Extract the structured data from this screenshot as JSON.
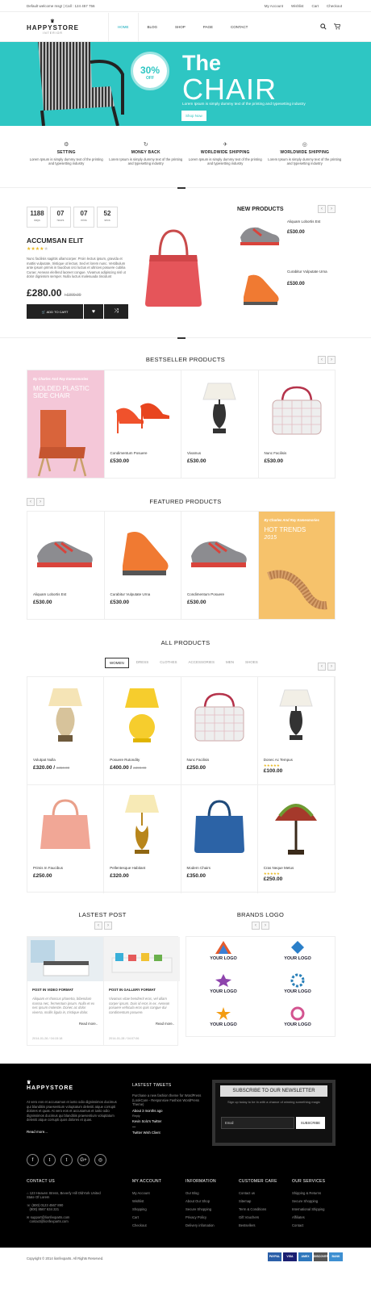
{
  "topbar": {
    "welcome": "Default welcome msg! | Call : 124 457 756",
    "links": [
      "My Account",
      "Wishlist",
      "Cart",
      "Checkout"
    ]
  },
  "header": {
    "logo": "HAPPYSTORE",
    "logo_sub": "INTERIOR",
    "nav": [
      "HOME",
      "BLOG",
      "SHOP",
      "PAGE",
      "CONTACT"
    ]
  },
  "hero": {
    "badge_pct": "30%",
    "badge_off": "OFF",
    "title1": "The",
    "title2": "CHAIR",
    "sub": "Lorem Ipsum is simply dummy text of the printing and typesetting industry",
    "button": "Shop Now",
    "accent": "#2ec6c3"
  },
  "features": [
    {
      "title": "SETTING",
      "text": "Lorem Ipsum is simply dummy text of the printing and typesetting industry",
      "icon": "gear-icon"
    },
    {
      "title": "MONEY BACK",
      "text": "Lorem Ipsum is simply dummy text of the printing and typesetting industry",
      "icon": "refresh-icon"
    },
    {
      "title": "WORLDWIDE SHIPPING",
      "text": "Lorem Ipsum is simply dummy text of the printing and typesetting industry",
      "icon": "plane-icon"
    },
    {
      "title": "WORLDWIDE SHIPPING",
      "text": "Lorem Ipsum is simply dummy text of the printing and typesetting industry",
      "icon": "globe-icon"
    }
  ],
  "deal": {
    "countdown": [
      {
        "v": "1188",
        "u": "days"
      },
      {
        "v": "07",
        "u": "hours"
      },
      {
        "v": "07",
        "u": "mins"
      },
      {
        "v": "52",
        "u": "secs"
      }
    ],
    "name": "ACCUMSAN ELIT",
    "rating": 4,
    "desc": "Nunc facilisis sagittis ullamcorper. Proin lectus ipsum, gravida et mattis vulputate, tristique ut lectus. Sed et lorem nunc. Vestibulum ante ipsum primis in faucibus orci luctus et ultrices posuere cubilia Curae; Aenean eleifend laoreet congue. Vivamus adipiscing nisl ut dolor dignissim semper. Nulla luctus malesuada tincidunt",
    "price": "£280.00",
    "old": "/ £300.00",
    "add": "ADD TO CART"
  },
  "new_products": {
    "title": "NEW PRODUCTS",
    "items": [
      {
        "name": "Aliquam Lobortis Est",
        "price": "£530.00"
      },
      {
        "name": "Curabitur Vulputate Urna",
        "price": "£530.00"
      }
    ]
  },
  "bestseller": {
    "title": "BESTSELLER PRODUCTS",
    "promo_kicker": "By Charles And Ray Eamesmories",
    "promo_title": "MOLDED PLASTIC SIDE CHAIR",
    "promo_title_accent": "CHAIR",
    "items": [
      {
        "name": "Condimentum Posuere",
        "price": "£530.00"
      },
      {
        "name": "Vivamus",
        "price": "£530.00"
      },
      {
        "name": "Nunc Facilisis",
        "price": "£530.00"
      }
    ]
  },
  "featured": {
    "title": "FEATURED PRODUCTS",
    "promo_kicker": "By Charles And Ray Eamesmories",
    "promo_title": "HOT TRENDS",
    "promo_year": "2015",
    "items": [
      {
        "name": "Aliquam Lobortis Est",
        "price": "£530.00"
      },
      {
        "name": "Curabitur Vulputate Urna",
        "price": "£530.00"
      },
      {
        "name": "Condimentum Posuere",
        "price": "£530.00"
      }
    ]
  },
  "all": {
    "title": "ALL PRODUCTS",
    "tabs": [
      "WOMEN",
      "DRESS",
      "CLOTHES",
      "ACCESSORIES",
      "MEN",
      "SHOES"
    ],
    "items": [
      {
        "name": "Volutpat Nulla",
        "price": "£320.00 /",
        "old": "£350.00"
      },
      {
        "name": "Posuere Rutondity",
        "price": "£400.00 /",
        "old": "£390.00"
      },
      {
        "name": "Nunc Facilisis",
        "price": "£250.00",
        "old": ""
      },
      {
        "name": "Donec Ac Tempus",
        "price": "£100.00",
        "old": ""
      },
      {
        "name": "Primis In Faucibus",
        "price": "£250.00",
        "old": ""
      },
      {
        "name": "Pellentesque Habitant",
        "price": "£320.00",
        "old": ""
      },
      {
        "name": "Modern Chairs",
        "price": "£350.00",
        "old": ""
      },
      {
        "name": "Cras Neque Metus",
        "price": "£250.00",
        "old": ""
      }
    ]
  },
  "posts": {
    "title": "LASTEST POST",
    "items": [
      {
        "title": "POST IN VIDEO FORMAT",
        "desc": "Aliquam et rhoncus pharetra, bibendum massa nec, fermentum ipsum. Nulla et ex nec ipsum molestie. Donec ac dolor viverra, mollis ligula in, tristique dolor.",
        "more": "Read more..",
        "date": "2014-01-26 / 04:15:18"
      },
      {
        "title": "POST IN GALLERY FORMAT",
        "desc": "Vivamus vitae hendrerit eros, vel ullam corper ipsum. Duis id eros in ex. Aenean posuere vehicula eros quis congue dui condimentum posuere.",
        "more": "Read more..",
        "date": "2014-01-28 / 04:07:06"
      }
    ]
  },
  "brands": {
    "title": "BRANDS LOGO",
    "label": "YOUR LOGO"
  },
  "footer": {
    "logo": "HAPPYSTORE",
    "text": "At vero eos et accusamus et iusto odio dignissimos ducimus qui blanditiis praesentium voluptatum deleniti atque corrupti dolores et quas. At vero eos et accusamus et iusto odio dignissimos ducimus qui blanditiis praesentium voluptatum deleniti atque corrupti quos dolores et quas.",
    "more": "Read more...",
    "social": [
      "f",
      "t",
      "t",
      "G+",
      "◎"
    ],
    "tweets_title": "LASTEST TWEETS",
    "tweet": "Purchase a new fashion theme for WordPress (LookCare - Responsive Fashion WordPress Theme)",
    "tweet_time": "About 3 months ago",
    "tweet_reply": "Reply",
    "tweet_by": "Kevin Solo's Twitter",
    "tweet_dash": "—",
    "tweet_visit": "Twitter Wish Client",
    "news_title": "SUBSCRIBE TO OUR NEWSLETTER",
    "news_text": "Sign up today to be in with a chance of winning something magic",
    "news_placeholder": "Email",
    "news_button": "SUBSCRIBE",
    "contact_title": "CONTACT US",
    "contact": [
      "123 Heaven Stress, Beverly Hill OldYork United State Of Lorem",
      "(800) 0123 4567 890",
      "(800) 8567 634 221",
      "support@lionfexparts.com",
      "contact@lionfexparts.com"
    ],
    "cols": [
      {
        "title": "MY ACCOUNT",
        "items": [
          "My Account",
          "Wishlist",
          "Shopping",
          "Cart",
          "Checkout"
        ]
      },
      {
        "title": "INFORMATION",
        "items": [
          "Our Blog",
          "About Our Shop",
          "Secure Shopping",
          "Privacy Policy",
          "Delivery infomation"
        ]
      },
      {
        "title": "CUSTOMER CARE",
        "items": [
          "Contact us",
          "Sitemap",
          "Term & Conditions",
          "Gift Vouchers",
          "Bestsellers"
        ]
      },
      {
        "title": "OUR SERVICES",
        "items": [
          "Shipping & Returns",
          "Secure Shopping",
          "International Shipping",
          "Affiliates",
          "Contact"
        ]
      }
    ],
    "copyright": "Copyright © 2014 lionfexparts. All Rights Reserved.",
    "payments": [
      "PAYPAL",
      "VISA",
      "AMEX",
      "DISCOVER",
      "BANK"
    ]
  }
}
